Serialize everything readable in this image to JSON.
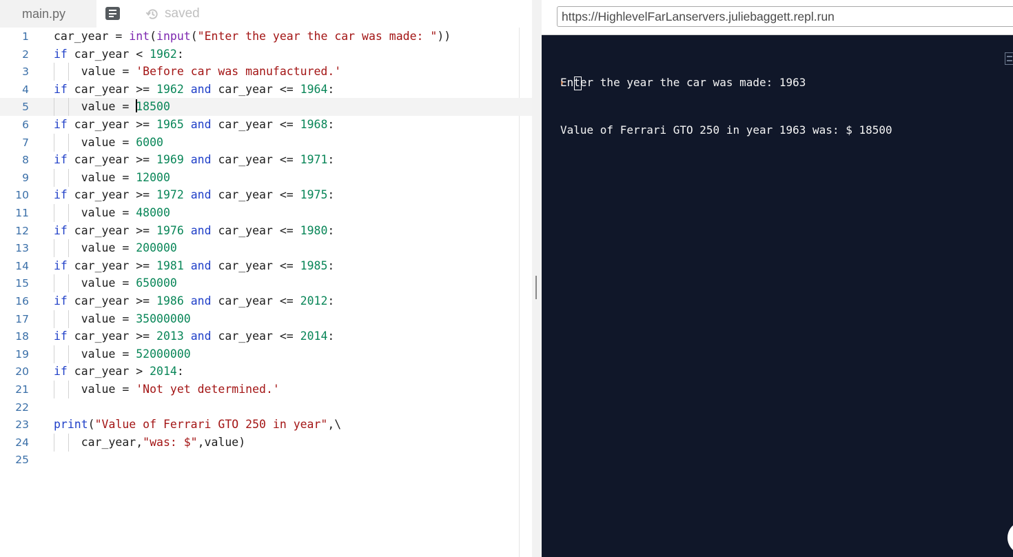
{
  "editor": {
    "tab_label": "main.py",
    "status_label": "saved",
    "active_line": 5,
    "line_numbers": [
      "1",
      "2",
      "3",
      "4",
      "5",
      "6",
      "7",
      "8",
      "9",
      "10",
      "11",
      "12",
      "13",
      "14",
      "15",
      "16",
      "17",
      "18",
      "19",
      "20",
      "21",
      "22",
      "23",
      "24",
      "25"
    ],
    "code_lines": [
      "car_year = int(input(\"Enter the year the car was made: \"))",
      "if car_year < 1962:",
      "    value = 'Before car was manufactured.'",
      "if car_year >= 1962 and car_year <= 1964:",
      "    value = 18500",
      "if car_year >= 1965 and car_year <= 1968:",
      "    value = 6000",
      "if car_year >= 1969 and car_year <= 1971:",
      "    value = 12000",
      "if car_year >= 1972 and car_year <= 1975:",
      "    value = 48000",
      "if car_year >= 1976 and car_year <= 1980:",
      "    value = 200000",
      "if car_year >= 1981 and car_year <= 1985:",
      "    value = 650000",
      "if car_year >= 1986 and car_year <= 2012:",
      "    value = 35000000",
      "if car_year >= 2013 and car_year <= 2014:",
      "    value = 52000000",
      "if car_year > 2014:",
      "    value = 'Not yet determined.'",
      "",
      "print(\"Value of Ferrari GTO 250 in year\",\\",
      "    car_year,\"was: $\",value)",
      ""
    ]
  },
  "console": {
    "url": "https://HighlevelFarLanservers.juliebaggett.repl.run",
    "output_lines": [
      "Enter the year the car was made: 1963",
      "Value of Ferrari GTO 250 in year 1963 was: $ 18500"
    ],
    "prompt_symbol": "›"
  },
  "icons": {
    "notes": "notes-icon",
    "saved": "history-icon",
    "prompt": "prompt-arrow-icon",
    "console_side": "list-icon"
  },
  "colors": {
    "keyword": "#1f3fc8",
    "builtin": "#7d27b0",
    "string": "#a31515",
    "number": "#098658",
    "line_number": "#3a6fa8",
    "console_bg": "#101729",
    "prompt": "#f26207"
  }
}
